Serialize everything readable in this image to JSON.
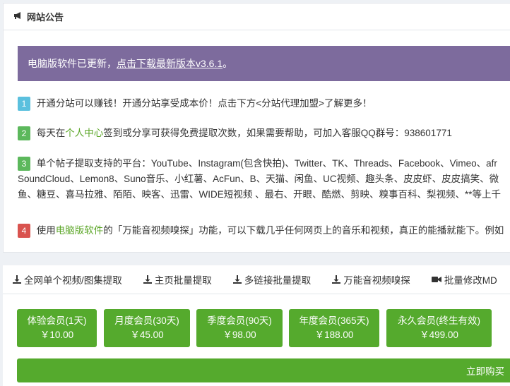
{
  "notice_panel": {
    "title": "网站公告",
    "banner": {
      "prefix": "电脑版软件已更新，",
      "link": "点击下载最新版本v3.6.1",
      "suffix": "。"
    },
    "items": [
      {
        "num": "1",
        "text": "开通分站可以赚钱！开通分站享受成本价！点击下方<分站代理加盟>了解更多！"
      },
      {
        "num": "2",
        "pre": "每天在",
        "link": "个人中心",
        "text": "签到或分享可获得免费提取次数，如果需要帮助，可加入客服QQ群号：938601771"
      },
      {
        "num": "3",
        "line1": "单个帖子提取支持的平台：YouTube、Instagram(包含快拍)、Twitter、TK、Threads、Facebook、Vimeo、afr",
        "line2": "SoundCloud、Lemon8、Suno音乐、小红薯、AcFun、B、天猫、闲鱼、UC视频、趣头条、皮皮虾、皮皮搞笑、微",
        "line3": "鱼、糖豆、喜马拉雅、陌陌、映客、迅雷、WIDE短视频 、最右、开眼、酷燃、剪映、糗事百科、梨视频、**等上千"
      },
      {
        "num": "4",
        "pre": "使用",
        "link": "电脑版软件",
        "text": "的「万能音视频嗅探」功能，可以下载几乎任何网页上的音乐和视频，真正的能播就能下。例如"
      }
    ]
  },
  "tabs": [
    {
      "label": "全网单个视频/图集提取",
      "icon": "download-icon"
    },
    {
      "label": "主页批量提取",
      "icon": "download-icon"
    },
    {
      "label": "多链接批量提取",
      "icon": "download-icon"
    },
    {
      "label": "万能音视频嗅探",
      "icon": "download-icon"
    },
    {
      "label": "批量修改MD",
      "icon": "video-icon"
    }
  ],
  "plans": [
    {
      "name": "体验会员(1天)",
      "price": "￥10.00"
    },
    {
      "name": "月度会员(30天)",
      "price": "￥45.00"
    },
    {
      "name": "季度会员(90天)",
      "price": "￥98.00"
    },
    {
      "name": "年度会员(365天)",
      "price": "￥188.00"
    },
    {
      "name": "永久会员(终生有效)",
      "price": "￥499.00"
    }
  ],
  "buy_label": "立即购买",
  "colors": {
    "banner": "#7d6b9d",
    "green": "#55aa2d",
    "link_green": "#5ba627"
  }
}
